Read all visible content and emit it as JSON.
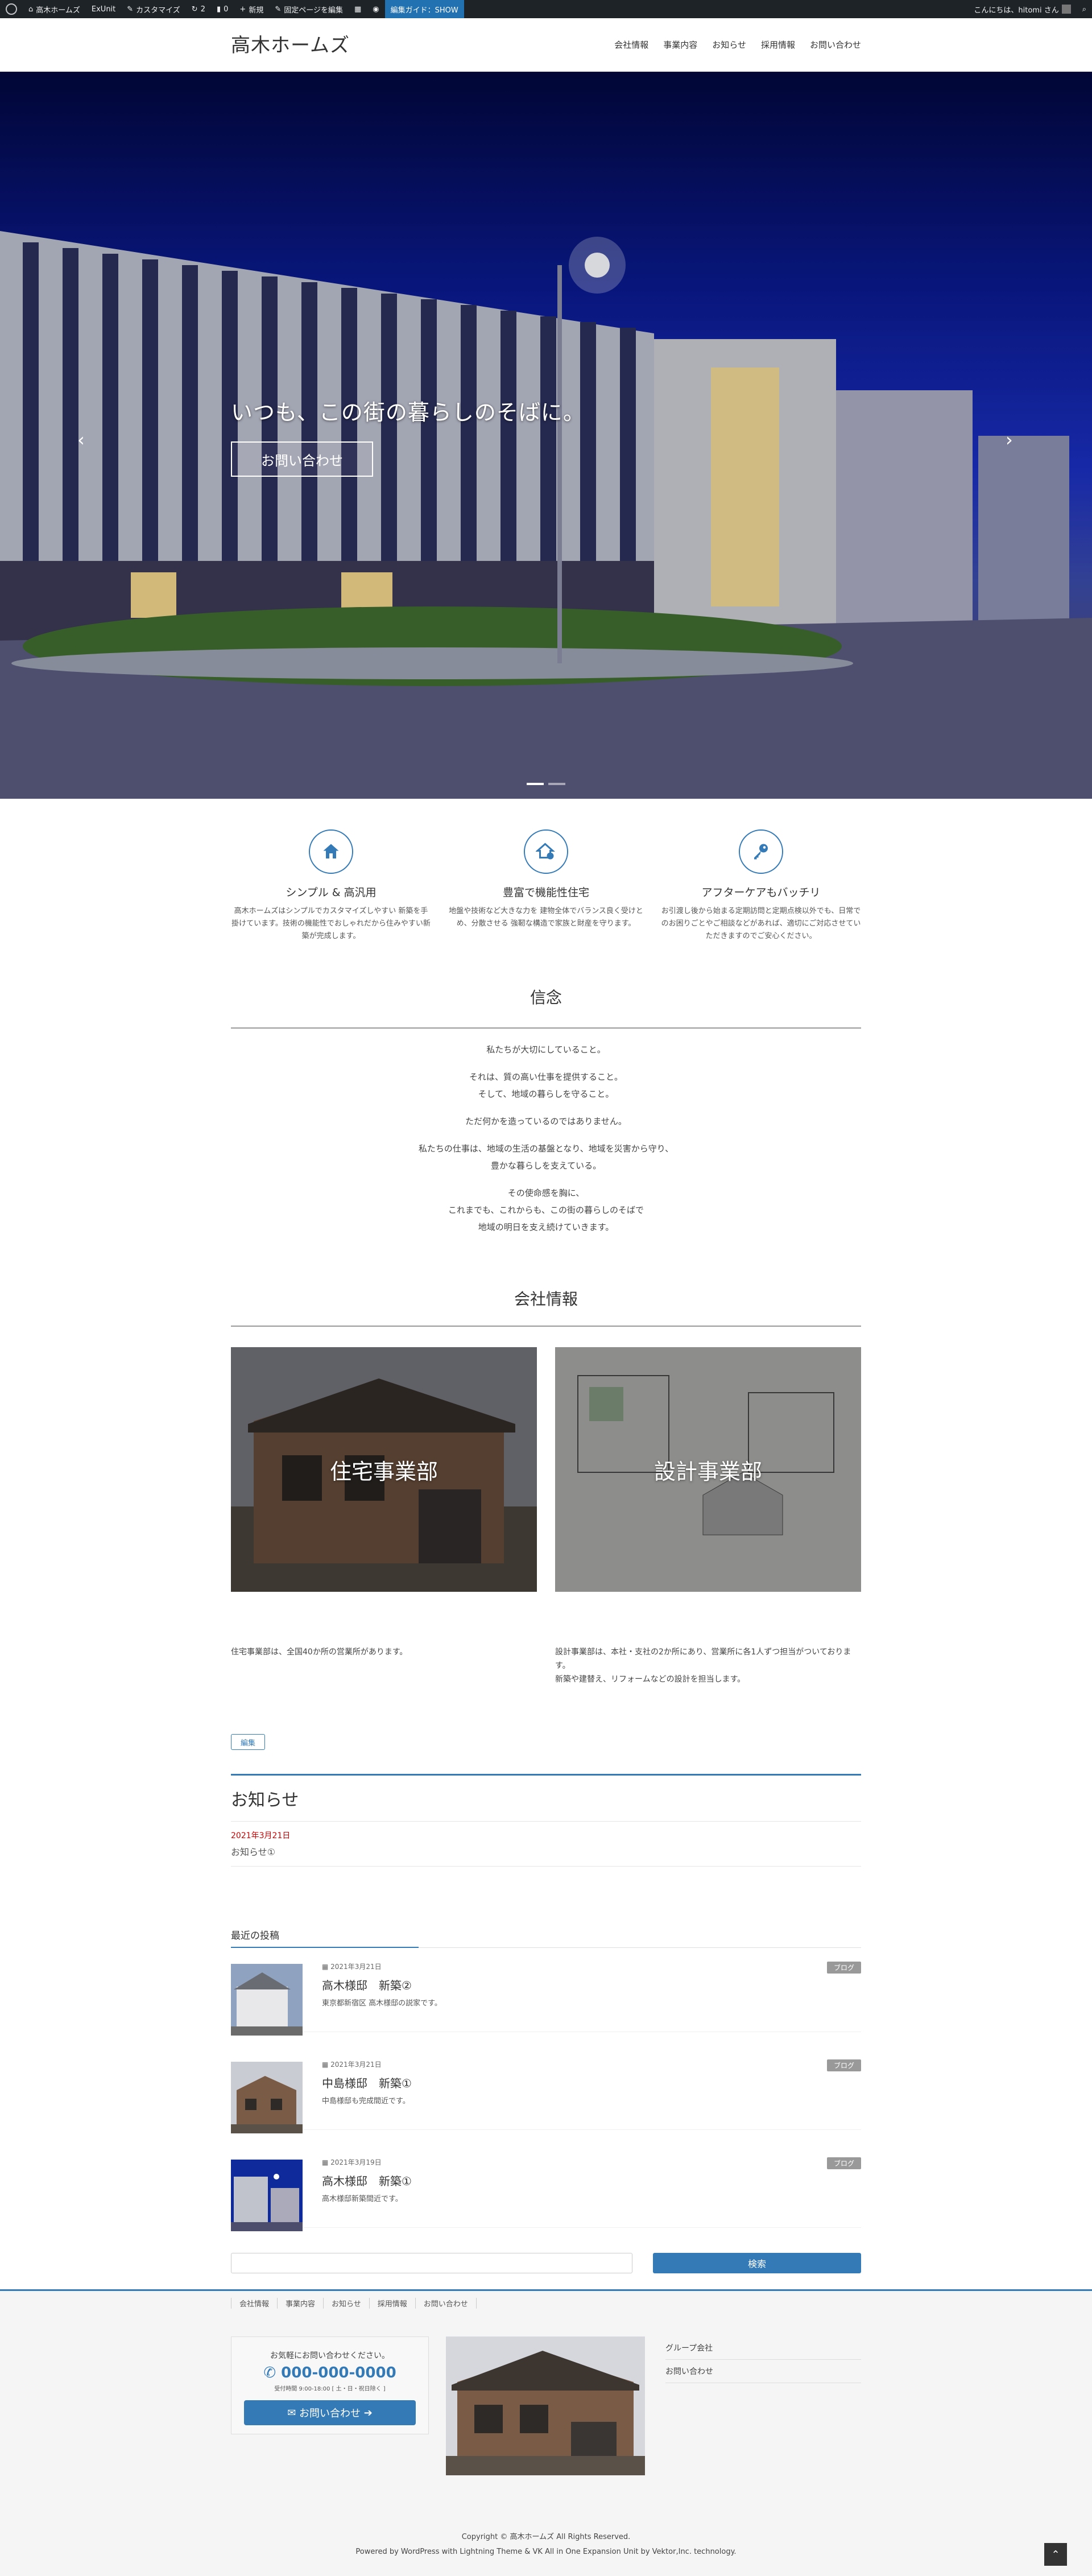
{
  "adminbar": {
    "site": "高木ホームズ",
    "exunit": "ExUnit",
    "customize": "カスタマイズ",
    "updates": "2",
    "comments": "0",
    "new": "新規",
    "edit_fixed": "固定ページを編集",
    "guide": "編集ガイド：SHOW",
    "greeting": "こんにちは、hitomi さん"
  },
  "header": {
    "logo": "高木ホームズ",
    "nav": [
      "会社情報",
      "事業内容",
      "お知らせ",
      "採用情報",
      "お問い合わせ"
    ]
  },
  "hero": {
    "caption": "いつも、この街の暮らしのそばに。",
    "button": "お問い合わせ",
    "prev": "‹",
    "next": "›"
  },
  "features": [
    {
      "icon": "house-icon",
      "title": "シンプル & 高汎用",
      "text": "高木ホームズはシンプルでカスタマイズしやすい 新築を手掛けています。技術の機能性でおしゃれだから住みやすい新築が完成します。"
    },
    {
      "icon": "house-gear-icon",
      "title": "豊富で機能性住宅",
      "text": "地盤や技術など大きな力を 建物全体でバランス良く受けとめ、分散させる 強靭な構造で家族と財産を守ります。"
    },
    {
      "icon": "key-icon",
      "title": "アフターケアもバッチリ",
      "text": "お引渡し後から始まる定期訪問と定期点検以外でも、日常でのお困りごとやご相談などがあれば、適切にご対応させていただきますのでご安心ください。"
    }
  ],
  "belief": {
    "title": "信念",
    "paras": [
      [
        "私たちが大切にしていること。"
      ],
      [
        "それは、質の高い仕事を提供すること。",
        "そして、地域の暮らしを守ること。"
      ],
      [
        "ただ何かを造っているのではありません。"
      ],
      [
        "私たちの仕事は、地域の生活の基盤となり、地域を災害から守り、",
        "豊かな暮らしを支えている。"
      ],
      [
        "その使命感を胸に、",
        "これまでも、これからも、この街の暮らしのそばで",
        "地域の明日を支え続けていきます。"
      ]
    ]
  },
  "company": {
    "title": "会社情報",
    "left_label": "住宅事業部",
    "right_label": "設計事業部",
    "left_desc": "住宅事業部は、全国40か所の営業所があります。",
    "right_desc": [
      "設計事業部は、本社・支社の2か所にあり、営業所に各1人ずつ担当がついております。",
      "新築や建替え、リフォームなどの設計を担当します。"
    ]
  },
  "edit_label": "編集",
  "news": {
    "title": "お知らせ",
    "date": "2021年3月21日",
    "item": "お知らせ①"
  },
  "recent": {
    "title": "最近の投稿",
    "posts": [
      {
        "date": "2021年3月21日",
        "title": "高木様邸　新築②",
        "excerpt": "東京都新宿区 高木様邸の説家です。",
        "tag": "ブログ"
      },
      {
        "date": "2021年3月21日",
        "title": "中島様邸　新築①",
        "excerpt": "中島様邸も完成間近です。",
        "tag": "ブログ"
      },
      {
        "date": "2021年3月19日",
        "title": "高木様邸　新築①",
        "excerpt": "高木様邸新築間近です。",
        "tag": "ブログ"
      }
    ]
  },
  "search": {
    "button": "検索",
    "placeholder": ""
  },
  "footer": {
    "nav": [
      "会社情報",
      "事業内容",
      "お知らせ",
      "採用情報",
      "お問い合わせ"
    ],
    "contact_lead": "お気軽にお問い合わせください。",
    "tel": "000-000-0000",
    "hours": "受付時間 9:00-18:00 [ 土・日・祝日除く ]",
    "mail_button": "お問い合わせ",
    "group": [
      "グループ会社",
      "お問い合わせ"
    ],
    "copyright": "Copyright © 高木ホームズ All Rights Reserved.",
    "powered": "Powered by WordPress with Lightning Theme & VK All in One Expansion Unit by Vektor,Inc. technology."
  }
}
